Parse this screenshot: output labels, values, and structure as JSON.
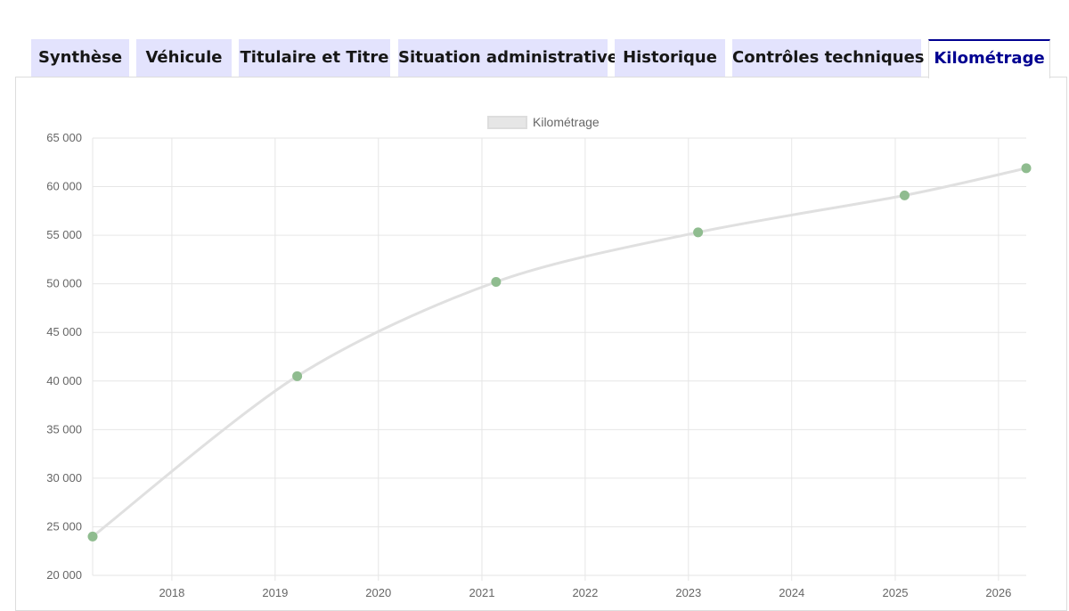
{
  "tabs": [
    {
      "label": "Synthèse",
      "active": false
    },
    {
      "label": "Véhicule",
      "active": false
    },
    {
      "label": "Titulaire et Titre",
      "active": false
    },
    {
      "label": "Situation administrative",
      "active": false
    },
    {
      "label": "Historique",
      "active": false
    },
    {
      "label": "Contrôles techniques",
      "active": false
    },
    {
      "label": "Kilométrage",
      "active": true
    }
  ],
  "colors": {
    "tab_bg": "#e3e3fd",
    "tab_active_text": "#000091",
    "line": "#e0e0e0",
    "point": "#8fbc8f"
  },
  "chart_data": {
    "type": "line",
    "title": "",
    "xlabel": "",
    "ylabel": "",
    "legend": {
      "position": "top-center",
      "entries": [
        "Kilométrage"
      ]
    },
    "grid": true,
    "xlim": [
      "2017-03-27",
      "2026-04-09"
    ],
    "ylim": [
      20000,
      65000
    ],
    "x_ticks": [
      "2018",
      "2019",
      "2020",
      "2021",
      "2022",
      "2023",
      "2024",
      "2025",
      "2026"
    ],
    "y_ticks": [
      "20 000",
      "25 000",
      "30 000",
      "35 000",
      "40 000",
      "45 000",
      "50 000",
      "55 000",
      "60 000",
      "65 000"
    ],
    "series": [
      {
        "name": "Kilométrage",
        "x": [
          "2017-03-27",
          "2019-03-20",
          "2021-02-20",
          "2023-02-04",
          "2025-02-03",
          "2026-04-09"
        ],
        "values": [
          24000,
          40500,
          50200,
          55300,
          59100,
          61900
        ]
      }
    ]
  }
}
